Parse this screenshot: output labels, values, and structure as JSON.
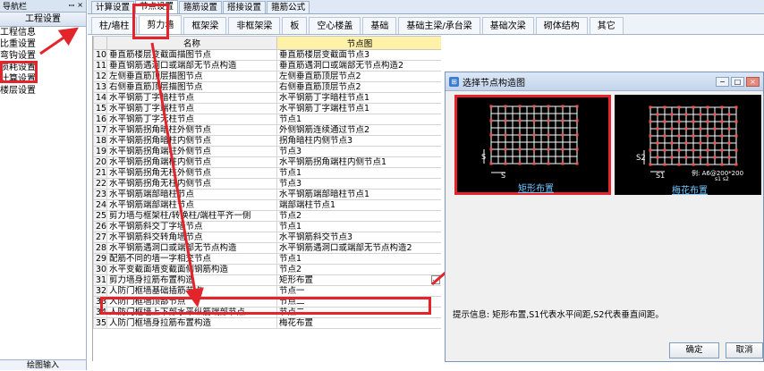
{
  "nav": {
    "title": "导航栏",
    "pin_glyph": "ꟷ",
    "close_glyph": "×",
    "section": "工程设置",
    "items": [
      "工程信息",
      "比重设置",
      "弯钩设置",
      "损耗设置",
      "计算设置",
      "楼层设置"
    ],
    "bottom": "绘图输入"
  },
  "top_tabs": [
    "计算设置",
    "节点设置",
    "箍筋设置",
    "搭接设置",
    "箍筋公式"
  ],
  "sub_tabs": [
    "柱/墙柱",
    "剪力墙",
    "框架梁",
    "非框架梁",
    "板",
    "空心楼盖",
    "基础",
    "基础主梁/承台梁",
    "基础次梁",
    "砌体结构",
    "其它"
  ],
  "grid": {
    "headers": [
      "名称",
      "节点图"
    ],
    "rows": [
      {
        "no": "10",
        "name": "垂直筋楼层变截面描图节点",
        "value": "垂直筋楼层变截面节点3"
      },
      {
        "no": "11",
        "name": "垂直钢筋遇洞口或端部无节点构造",
        "value": "垂直筋遇洞口或端部无节点构造2"
      },
      {
        "no": "12",
        "name": "左侧垂直筋顶层描图节点",
        "value": "左侧垂直筋顶层节点2"
      },
      {
        "no": "13",
        "name": "右侧垂直筋顶层描图节点",
        "value": "右侧垂直筋顶层节点2"
      },
      {
        "no": "14",
        "name": "水平钢筋丁字暗柱节点",
        "value": "水平钢筋丁字暗柱节点1"
      },
      {
        "no": "15",
        "name": "水平钢筋丁字端柱节点",
        "value": "水平钢筋丁字端柱节点1"
      },
      {
        "no": "16",
        "name": "水平钢筋丁字无柱节点",
        "value": "节点1"
      },
      {
        "no": "17",
        "name": "水平钢筋拐角暗柱外侧节点",
        "value": "外侧钢筋连续通过节点2"
      },
      {
        "no": "18",
        "name": "水平钢筋拐角暗柱内侧节点",
        "value": "拐角暗柱内侧节点3"
      },
      {
        "no": "19",
        "name": "水平钢筋拐角端柱外侧节点",
        "value": "节点3"
      },
      {
        "no": "20",
        "name": "水平钢筋拐角端柱内侧节点",
        "value": "水平钢筋拐角端柱内侧节点1"
      },
      {
        "no": "21",
        "name": "水平钢筋拐角无柱外侧节点",
        "value": "节点1"
      },
      {
        "no": "22",
        "name": "水平钢筋拐角无柱内侧节点",
        "value": "节点3"
      },
      {
        "no": "23",
        "name": "水平钢筋端部暗柱节点",
        "value": "水平钢筋端部暗柱节点1"
      },
      {
        "no": "24",
        "name": "水平钢筋端部端柱节点",
        "value": "端部端柱节点1"
      },
      {
        "no": "25",
        "name": "剪力墙与框架柱/转换柱/端柱平齐一侧",
        "value": "节点2"
      },
      {
        "no": "26",
        "name": "水平钢筋斜交丁字墙节点",
        "value": "节点1"
      },
      {
        "no": "27",
        "name": "水平钢筋斜交转角墙节点",
        "value": "水平钢筋斜交节点3"
      },
      {
        "no": "28",
        "name": "水平钢筋遇洞口或端部无节点构造",
        "value": "水平钢筋遇洞口或端部无节点构造2"
      },
      {
        "no": "29",
        "name": "配筋不同的墙一字相交节点",
        "value": "节点1"
      },
      {
        "no": "30",
        "name": "水平变截面墙变截面侧钢筋构造",
        "value": "节点2"
      },
      {
        "no": "31",
        "name": "剪力墙身拉筋布置构造",
        "value": "矩形布置"
      },
      {
        "no": "32",
        "name": "人防门框墙基础插筋节点",
        "value": "节点一"
      },
      {
        "no": "33",
        "name": "人防门框墙顶部节点",
        "value": "节点二"
      },
      {
        "no": "34",
        "name": "人防门框墙上下部水平纵筋端部节点",
        "value": "节点二"
      },
      {
        "no": "35",
        "name": "人防门框墙身拉筋布置构造",
        "value": "梅花布置"
      }
    ]
  },
  "dialog": {
    "title": "选择节点构造图",
    "left_caption": "矩形布置",
    "right_caption": "梅花布置",
    "left_s_label": "S",
    "right_s2_label": "S2",
    "right_s1_label": "S1",
    "right_example": "例: A6@200*200",
    "right_example_sub": "s1  s2",
    "tip": "提示信息:  矩形布置,S1代表水平间距,S2代表垂直间距。",
    "ok": "确定",
    "cancel": "取消"
  },
  "colors": {
    "highlight_red": "#e3242b",
    "header_yellow": "#fff2a8",
    "caption_blue": "#6ec6ff",
    "rebar_red": "#ff5050"
  }
}
